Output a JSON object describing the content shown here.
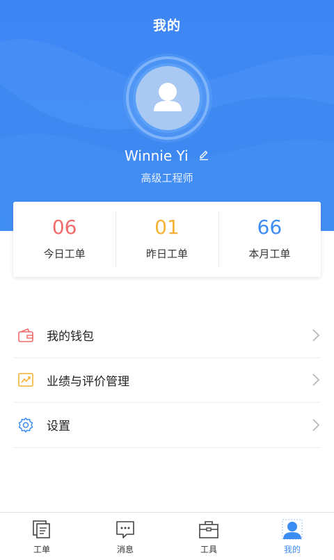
{
  "header": {
    "title": "我的",
    "user_name": "Winnie Yi",
    "user_role": "高级工程师"
  },
  "stats": [
    {
      "value": "06",
      "label": "今日工单",
      "color": "#f26b6b"
    },
    {
      "value": "01",
      "label": "昨日工单",
      "color": "#f5b234"
    },
    {
      "value": "66",
      "label": "本月工单",
      "color": "#3b8cf3"
    }
  ],
  "menu": [
    {
      "label": "我的钱包",
      "icon": "wallet-icon",
      "color": "#f26b6b"
    },
    {
      "label": "业绩与评价管理",
      "icon": "trend-chart-icon",
      "color": "#f5b234"
    },
    {
      "label": "设置",
      "icon": "gear-icon",
      "color": "#3b8cf3"
    }
  ],
  "tabbar": [
    {
      "label": "工单",
      "icon": "work-order-icon",
      "active": false
    },
    {
      "label": "消息",
      "icon": "message-icon",
      "active": false
    },
    {
      "label": "工具",
      "icon": "toolbox-icon",
      "active": false
    },
    {
      "label": "我的",
      "icon": "user-icon",
      "active": true
    }
  ],
  "colors": {
    "primary": "#3b8cf3",
    "red": "#f26b6b",
    "yellow": "#f5b234"
  }
}
